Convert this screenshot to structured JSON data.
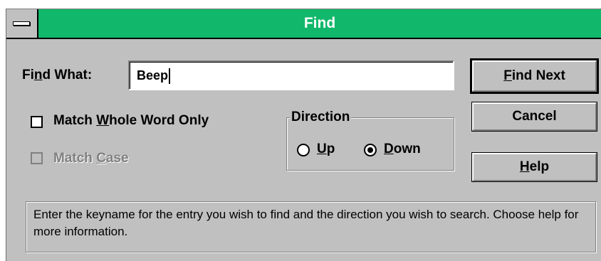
{
  "window": {
    "title": "Find",
    "titlebar_color": "#11b86b",
    "face_color": "#c0c0c0"
  },
  "find_what": {
    "label_before": "Fi",
    "label_mnemonic": "n",
    "label_after": "d What:",
    "value": "Beep"
  },
  "options": {
    "whole_word": {
      "before": "Match ",
      "mnemonic": "W",
      "after": "hole Word Only",
      "checked": false,
      "enabled": true
    },
    "match_case": {
      "before": "Match ",
      "mnemonic": "C",
      "after": "ase",
      "checked": false,
      "enabled": false
    }
  },
  "direction": {
    "title": "Direction",
    "up": {
      "mnemonic": "U",
      "after": "p",
      "selected": false
    },
    "down": {
      "mnemonic": "D",
      "after": "own",
      "selected": true
    }
  },
  "buttons": {
    "find_next": {
      "mnemonic": "F",
      "after": "ind Next"
    },
    "cancel": {
      "label": "Cancel"
    },
    "help": {
      "mnemonic": "H",
      "after": "elp"
    }
  },
  "status_text": "Enter the keyname for the entry you wish to find and the direction you wish to search. Choose help for more information.",
  "icons": {
    "system_menu": "system-menu-icon"
  }
}
